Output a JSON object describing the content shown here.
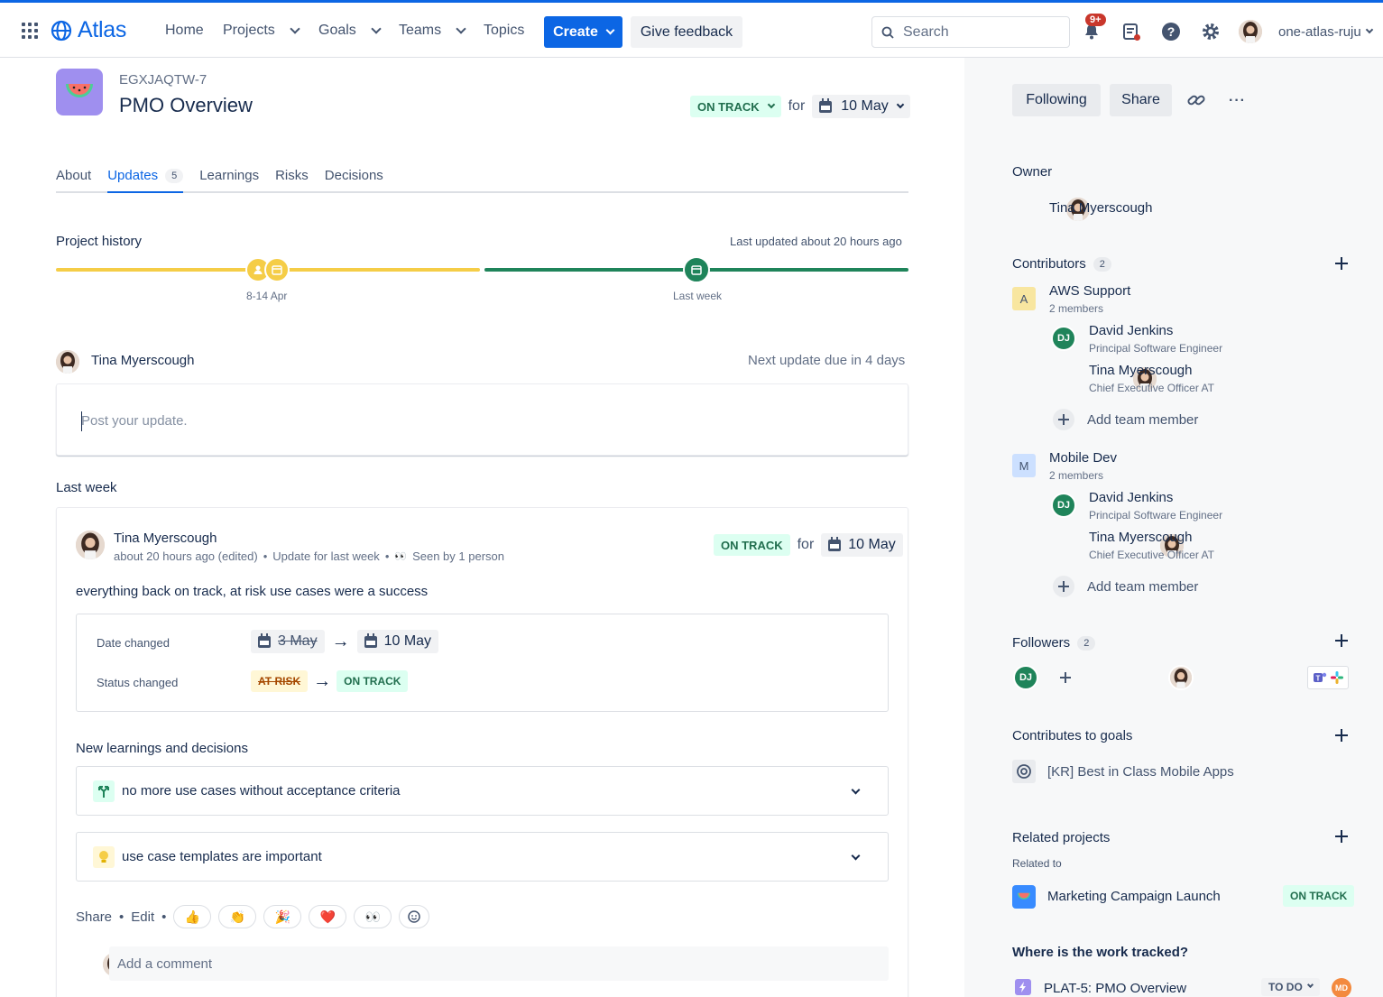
{
  "nav": {
    "app_name": "Atlas",
    "items": [
      {
        "label": "Home"
      },
      {
        "label": "Projects"
      },
      {
        "label": "Goals"
      },
      {
        "label": "Teams"
      },
      {
        "label": "Topics"
      }
    ],
    "create_label": "Create",
    "feedback_label": "Give feedback",
    "search_placeholder": "Search",
    "notifications_badge": "9+",
    "username": "one-atlas-ruju",
    "brand_color": "#0c66e4"
  },
  "project": {
    "key": "EGXJAQTW-7",
    "title": "PMO Overview",
    "status": "ON TRACK",
    "for_label": "for",
    "target_date": "10 May"
  },
  "tabs": [
    {
      "label": "About"
    },
    {
      "label": "Updates",
      "count": "5"
    },
    {
      "label": "Learnings"
    },
    {
      "label": "Risks"
    },
    {
      "label": "Decisions"
    }
  ],
  "history": {
    "title": "Project history",
    "last_updated": "Last updated about 20 hours ago",
    "points": [
      {
        "label": "8-14 Apr",
        "color": "#f5cd47"
      },
      {
        "label": "Last week",
        "color": "#1f845a"
      }
    ]
  },
  "composer": {
    "author": "Tina Myerscough",
    "next_due": "Next update due in 4 days",
    "placeholder": "Post your update."
  },
  "last_week": {
    "heading": "Last week",
    "author": "Tina Myerscough",
    "time": "about 20 hours ago (edited)",
    "update_for": "Update for last week",
    "seen": "Seen by 1 person",
    "status": "ON TRACK",
    "for_label": "for",
    "date": "10 May",
    "body": "everything back on track, at risk use cases were a success",
    "changes": {
      "date_label": "Date changed",
      "date_from": "3 May",
      "date_to": "10 May",
      "status_label": "Status changed",
      "status_from": "AT RISK",
      "status_to": "ON TRACK"
    },
    "learnings_heading": "New learnings and decisions",
    "learnings": [
      {
        "text": "no more use cases without acceptance criteria",
        "icon": "decision-icon"
      },
      {
        "text": "use case templates are important",
        "icon": "lightbulb-icon"
      }
    ],
    "share_label": "Share",
    "edit_label": "Edit",
    "reactions": [
      "👍",
      "👏",
      "🎉",
      "❤️",
      "👀"
    ],
    "comment_placeholder": "Add a comment"
  },
  "sidebar": {
    "following_label": "Following",
    "share_label": "Share",
    "owner_heading": "Owner",
    "owner_name": "Tina Myerscough",
    "contributors_heading": "Contributors",
    "contributors_count": "2",
    "teams": [
      {
        "initial": "A",
        "name": "AWS Support",
        "members_label": "2 members",
        "color": "#f8e6a0",
        "members": [
          {
            "initials": "DJ",
            "name": "David Jenkins",
            "role": "Principal Software Engineer"
          },
          {
            "initials": "",
            "name": "Tina Myerscough",
            "role": "Chief Executive Officer AT"
          }
        ],
        "add_label": "Add team member"
      },
      {
        "initial": "M",
        "name": "Mobile Dev",
        "members_label": "2 members",
        "color": "#cce0ff",
        "members": [
          {
            "initials": "DJ",
            "name": "David Jenkins",
            "role": "Principal Software Engineer"
          },
          {
            "initials": "",
            "name": "Tina Myerscough",
            "role": "Chief Executive Officer AT"
          }
        ],
        "add_label": "Add team member"
      }
    ],
    "followers_heading": "Followers",
    "followers_count": "2",
    "follower_initials": "DJ",
    "goals_heading": "Contributes to goals",
    "goal": "[KR] Best in Class Mobile Apps",
    "related_heading": "Related projects",
    "related_sub": "Related to",
    "related_project": "Marketing Campaign Launch",
    "related_status": "ON TRACK",
    "tracked_heading": "Where is the work tracked?",
    "tracked_item": "PLAT-5: PMO Overview",
    "tracked_status": "TO DO",
    "tracked_assignee": "MD"
  }
}
